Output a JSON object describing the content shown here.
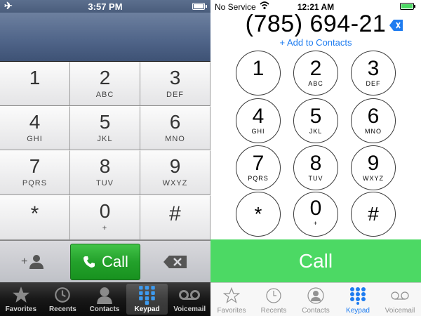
{
  "left": {
    "status": {
      "time": "3:57 PM",
      "icon": "airplane-icon",
      "battery_level": 0.9
    },
    "keys": [
      {
        "digit": "1",
        "letters": ""
      },
      {
        "digit": "2",
        "letters": "ABC"
      },
      {
        "digit": "3",
        "letters": "DEF"
      },
      {
        "digit": "4",
        "letters": "GHI"
      },
      {
        "digit": "5",
        "letters": "JKL"
      },
      {
        "digit": "6",
        "letters": "MNO"
      },
      {
        "digit": "7",
        "letters": "PQRS"
      },
      {
        "digit": "8",
        "letters": "TUV"
      },
      {
        "digit": "9",
        "letters": "WXYZ"
      },
      {
        "digit": "*",
        "letters": ""
      },
      {
        "digit": "0",
        "letters": "+"
      },
      {
        "digit": "#",
        "letters": ""
      }
    ],
    "call_label": "Call",
    "colors": {
      "call": "#23a12b",
      "header": "#51668a"
    },
    "tabs": [
      {
        "label": "Favorites",
        "icon": "star-icon"
      },
      {
        "label": "Recents",
        "icon": "clock-icon"
      },
      {
        "label": "Contacts",
        "icon": "person-icon"
      },
      {
        "label": "Keypad",
        "icon": "keypad-icon",
        "active": true
      },
      {
        "label": "Voicemail",
        "icon": "voicemail-icon"
      }
    ]
  },
  "right": {
    "status": {
      "carrier": "No Service",
      "time": "12:21 AM",
      "icon": "wifi-icon",
      "battery_level": 0.9
    },
    "number": "(785) 694-21",
    "add_contacts": "+ Add to Contacts",
    "keys": [
      {
        "digit": "1",
        "letters": ""
      },
      {
        "digit": "2",
        "letters": "ABC"
      },
      {
        "digit": "3",
        "letters": "DEF"
      },
      {
        "digit": "4",
        "letters": "GHI"
      },
      {
        "digit": "5",
        "letters": "JKL"
      },
      {
        "digit": "6",
        "letters": "MNO"
      },
      {
        "digit": "7",
        "letters": "PQRS"
      },
      {
        "digit": "8",
        "letters": "TUV"
      },
      {
        "digit": "9",
        "letters": "WXYZ"
      },
      {
        "digit": "*",
        "letters": ""
      },
      {
        "digit": "0",
        "letters": "+"
      },
      {
        "digit": "#",
        "letters": ""
      }
    ],
    "call_label": "Call",
    "colors": {
      "call": "#4cd964",
      "accent": "#1e7cf0"
    },
    "tabs": [
      {
        "label": "Favorites",
        "icon": "star-icon"
      },
      {
        "label": "Recents",
        "icon": "clock-icon"
      },
      {
        "label": "Contacts",
        "icon": "person-icon"
      },
      {
        "label": "Keypad",
        "icon": "keypad-icon",
        "active": true
      },
      {
        "label": "Voicemail",
        "icon": "voicemail-icon"
      }
    ]
  }
}
